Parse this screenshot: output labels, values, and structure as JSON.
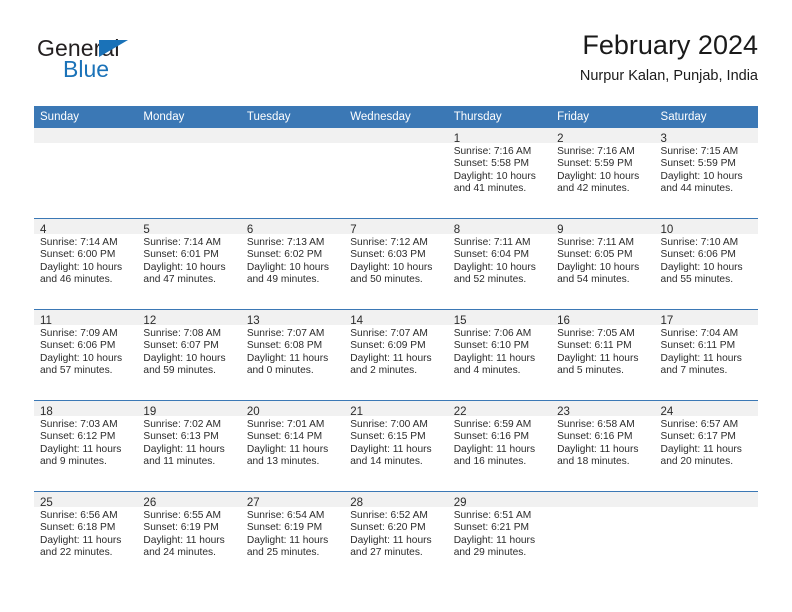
{
  "brand": {
    "name_primary": "General",
    "name_secondary": "Blue",
    "accent_color": "#1a72b8"
  },
  "header": {
    "title": "February 2024",
    "location": "Nurpur Kalan, Punjab, India"
  },
  "theme": {
    "header_bar_color": "#3b78b5",
    "daynum_band_color": "#f1f1f1",
    "text_color": "#2b2b2b"
  },
  "weekdays": [
    "Sunday",
    "Monday",
    "Tuesday",
    "Wednesday",
    "Thursday",
    "Friday",
    "Saturday"
  ],
  "weeks": [
    [
      {
        "day": "",
        "empty": true
      },
      {
        "day": "",
        "empty": true
      },
      {
        "day": "",
        "empty": true
      },
      {
        "day": "",
        "empty": true
      },
      {
        "day": "1",
        "sunrise": "Sunrise: 7:16 AM",
        "sunset": "Sunset: 5:58 PM",
        "daylight": "Daylight: 10 hours and 41 minutes."
      },
      {
        "day": "2",
        "sunrise": "Sunrise: 7:16 AM",
        "sunset": "Sunset: 5:59 PM",
        "daylight": "Daylight: 10 hours and 42 minutes."
      },
      {
        "day": "3",
        "sunrise": "Sunrise: 7:15 AM",
        "sunset": "Sunset: 5:59 PM",
        "daylight": "Daylight: 10 hours and 44 minutes."
      }
    ],
    [
      {
        "day": "4",
        "sunrise": "Sunrise: 7:14 AM",
        "sunset": "Sunset: 6:00 PM",
        "daylight": "Daylight: 10 hours and 46 minutes."
      },
      {
        "day": "5",
        "sunrise": "Sunrise: 7:14 AM",
        "sunset": "Sunset: 6:01 PM",
        "daylight": "Daylight: 10 hours and 47 minutes."
      },
      {
        "day": "6",
        "sunrise": "Sunrise: 7:13 AM",
        "sunset": "Sunset: 6:02 PM",
        "daylight": "Daylight: 10 hours and 49 minutes."
      },
      {
        "day": "7",
        "sunrise": "Sunrise: 7:12 AM",
        "sunset": "Sunset: 6:03 PM",
        "daylight": "Daylight: 10 hours and 50 minutes."
      },
      {
        "day": "8",
        "sunrise": "Sunrise: 7:11 AM",
        "sunset": "Sunset: 6:04 PM",
        "daylight": "Daylight: 10 hours and 52 minutes."
      },
      {
        "day": "9",
        "sunrise": "Sunrise: 7:11 AM",
        "sunset": "Sunset: 6:05 PM",
        "daylight": "Daylight: 10 hours and 54 minutes."
      },
      {
        "day": "10",
        "sunrise": "Sunrise: 7:10 AM",
        "sunset": "Sunset: 6:06 PM",
        "daylight": "Daylight: 10 hours and 55 minutes."
      }
    ],
    [
      {
        "day": "11",
        "sunrise": "Sunrise: 7:09 AM",
        "sunset": "Sunset: 6:06 PM",
        "daylight": "Daylight: 10 hours and 57 minutes."
      },
      {
        "day": "12",
        "sunrise": "Sunrise: 7:08 AM",
        "sunset": "Sunset: 6:07 PM",
        "daylight": "Daylight: 10 hours and 59 minutes."
      },
      {
        "day": "13",
        "sunrise": "Sunrise: 7:07 AM",
        "sunset": "Sunset: 6:08 PM",
        "daylight": "Daylight: 11 hours and 0 minutes."
      },
      {
        "day": "14",
        "sunrise": "Sunrise: 7:07 AM",
        "sunset": "Sunset: 6:09 PM",
        "daylight": "Daylight: 11 hours and 2 minutes."
      },
      {
        "day": "15",
        "sunrise": "Sunrise: 7:06 AM",
        "sunset": "Sunset: 6:10 PM",
        "daylight": "Daylight: 11 hours and 4 minutes."
      },
      {
        "day": "16",
        "sunrise": "Sunrise: 7:05 AM",
        "sunset": "Sunset: 6:11 PM",
        "daylight": "Daylight: 11 hours and 5 minutes."
      },
      {
        "day": "17",
        "sunrise": "Sunrise: 7:04 AM",
        "sunset": "Sunset: 6:11 PM",
        "daylight": "Daylight: 11 hours and 7 minutes."
      }
    ],
    [
      {
        "day": "18",
        "sunrise": "Sunrise: 7:03 AM",
        "sunset": "Sunset: 6:12 PM",
        "daylight": "Daylight: 11 hours and 9 minutes."
      },
      {
        "day": "19",
        "sunrise": "Sunrise: 7:02 AM",
        "sunset": "Sunset: 6:13 PM",
        "daylight": "Daylight: 11 hours and 11 minutes."
      },
      {
        "day": "20",
        "sunrise": "Sunrise: 7:01 AM",
        "sunset": "Sunset: 6:14 PM",
        "daylight": "Daylight: 11 hours and 13 minutes."
      },
      {
        "day": "21",
        "sunrise": "Sunrise: 7:00 AM",
        "sunset": "Sunset: 6:15 PM",
        "daylight": "Daylight: 11 hours and 14 minutes."
      },
      {
        "day": "22",
        "sunrise": "Sunrise: 6:59 AM",
        "sunset": "Sunset: 6:16 PM",
        "daylight": "Daylight: 11 hours and 16 minutes."
      },
      {
        "day": "23",
        "sunrise": "Sunrise: 6:58 AM",
        "sunset": "Sunset: 6:16 PM",
        "daylight": "Daylight: 11 hours and 18 minutes."
      },
      {
        "day": "24",
        "sunrise": "Sunrise: 6:57 AM",
        "sunset": "Sunset: 6:17 PM",
        "daylight": "Daylight: 11 hours and 20 minutes."
      }
    ],
    [
      {
        "day": "25",
        "sunrise": "Sunrise: 6:56 AM",
        "sunset": "Sunset: 6:18 PM",
        "daylight": "Daylight: 11 hours and 22 minutes."
      },
      {
        "day": "26",
        "sunrise": "Sunrise: 6:55 AM",
        "sunset": "Sunset: 6:19 PM",
        "daylight": "Daylight: 11 hours and 24 minutes."
      },
      {
        "day": "27",
        "sunrise": "Sunrise: 6:54 AM",
        "sunset": "Sunset: 6:19 PM",
        "daylight": "Daylight: 11 hours and 25 minutes."
      },
      {
        "day": "28",
        "sunrise": "Sunrise: 6:52 AM",
        "sunset": "Sunset: 6:20 PM",
        "daylight": "Daylight: 11 hours and 27 minutes."
      },
      {
        "day": "29",
        "sunrise": "Sunrise: 6:51 AM",
        "sunset": "Sunset: 6:21 PM",
        "daylight": "Daylight: 11 hours and 29 minutes."
      },
      {
        "day": "",
        "empty": true
      },
      {
        "day": "",
        "empty": true
      }
    ]
  ]
}
